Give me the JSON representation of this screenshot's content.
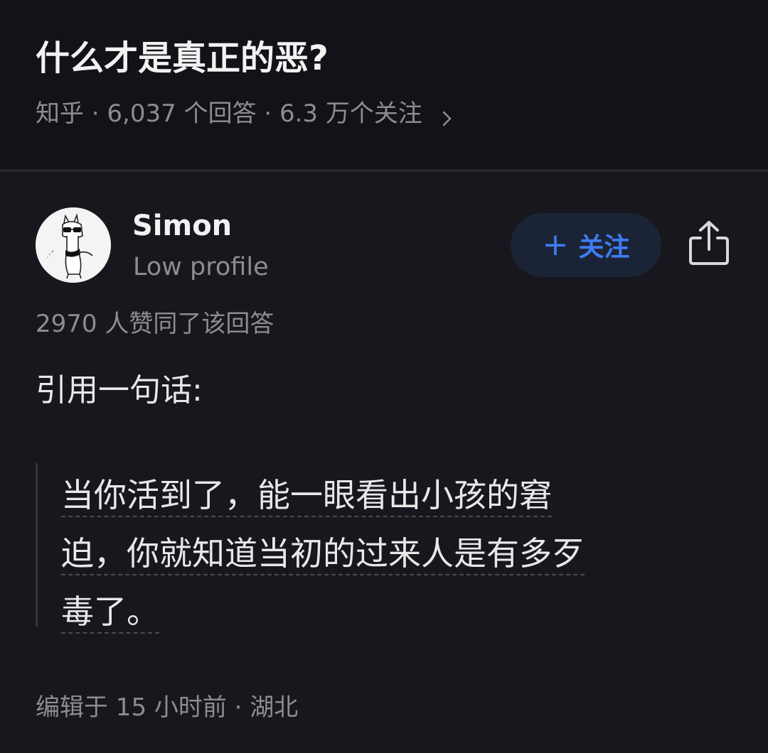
{
  "question": {
    "title": "什么才是真正的恶?",
    "meta": "知乎 · 6,037 个回答 · 6.3 万个关注"
  },
  "author": {
    "name": "Simon",
    "bio": "Low profile"
  },
  "actions": {
    "follow_plus": "+",
    "follow_label": "关注"
  },
  "answer": {
    "vote_summary": "2970 人赞同了该回答",
    "intro": "引用一句话:",
    "quote_lines": [
      "当你活到了，能一眼看出小孩的窘",
      "迫，你就知道当初的过来人是有多歹",
      "毒了。"
    ],
    "edit_info": "编辑于 15 小时前 · 湖北"
  },
  "colors": {
    "accent": "#3f7cf4",
    "background": "#121218",
    "card": "#17171d",
    "muted_text": "#8c8c92"
  },
  "icons": {
    "chevron": "chevron-right-icon",
    "share": "share-icon",
    "avatar": "alpaca-sunglasses-avatar"
  }
}
